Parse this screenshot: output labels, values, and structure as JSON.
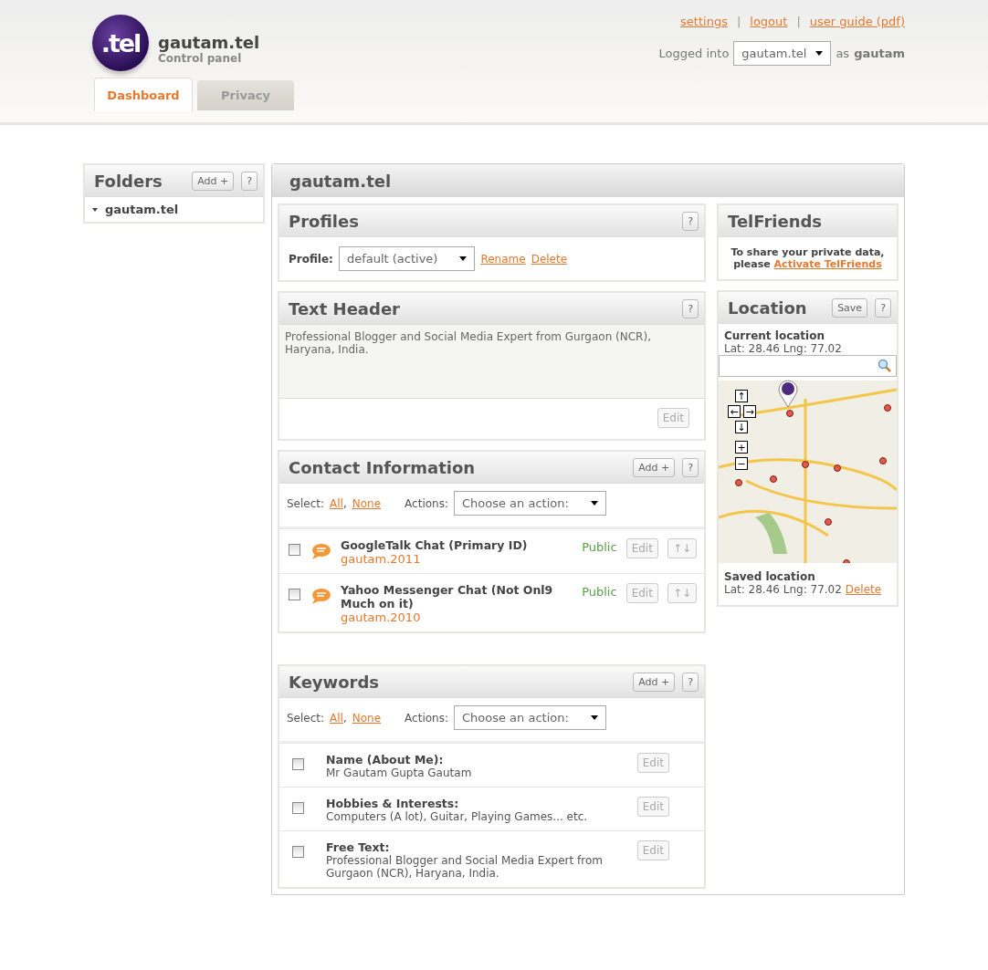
{
  "header": {
    "logo": ".tel",
    "site": "gautam.tel",
    "subtitle": "Control panel",
    "links": [
      "settings",
      "logout",
      "user guide (pdf)"
    ],
    "separator": "|",
    "logged_into_label": "Logged into",
    "account_select": "gautam.tel",
    "as_label": "as",
    "user": "gautam"
  },
  "tabs": [
    {
      "label": "Dashboard",
      "selected": true
    },
    {
      "label": "Privacy",
      "selected": false
    }
  ],
  "folders": {
    "title": "Folders",
    "add_button": "Add +",
    "help_button": "?",
    "items": [
      {
        "label": "gautam.tel",
        "expanded": true
      }
    ]
  },
  "main": {
    "title": "gautam.tel",
    "profiles": {
      "title": "Profiles",
      "help_button": "?",
      "label": "Profile:",
      "select": "default (active)",
      "links": [
        "Rename",
        "Delete"
      ]
    },
    "text_header": {
      "title": "Text Header",
      "help_button": "?",
      "text": "Professional Blogger and Social Media Expert from Gurgaon (NCR), Haryana, India.",
      "edit_button": "Edit"
    },
    "contacts": {
      "title": "Contact Information",
      "add_button": "Add +",
      "help_button": "?",
      "select_label": "Select:",
      "select_links": [
        "All",
        "None"
      ],
      "link_separator": ",",
      "actions_label": "Actions:",
      "actions_select": "Choose an action:",
      "items": [
        {
          "title": "GoogleTalk Chat (Primary ID)",
          "value": "gautam.2011",
          "visibility": "Public",
          "edit_button": "Edit",
          "move_button": "↑↓",
          "checked": false
        },
        {
          "title": "Yahoo Messenger Chat (Not Onl9 Much on it)",
          "value": "gautam.2010",
          "visibility": "Public",
          "edit_button": "Edit",
          "move_button": "↑↓",
          "checked": false
        }
      ]
    },
    "keywords": {
      "title": "Keywords",
      "add_button": "Add +",
      "help_button": "?",
      "select_label": "Select:",
      "select_links": [
        "All",
        "None"
      ],
      "link_separator": ",",
      "actions_label": "Actions:",
      "actions_select": "Choose an action:",
      "items": [
        {
          "title": "Name (About Me):",
          "value": "Mr Gautam Gupta Gautam",
          "edit_button": "Edit",
          "checked": false
        },
        {
          "title": "Hobbies & Interests:",
          "value": "Computers (A lot), Guitar, Playing Games... etc.",
          "edit_button": "Edit",
          "checked": false
        },
        {
          "title": "Free Text:",
          "value": "Professional Blogger and Social Media Expert from Gurgaon (NCR), Haryana, India.",
          "edit_button": "Edit",
          "checked": false
        }
      ]
    },
    "telfriends": {
      "title": "TelFriends",
      "text": "To share your private data, please",
      "link": "Activate TelFriends"
    },
    "location": {
      "title": "Location",
      "save_button": "Save",
      "help_button": "?",
      "current_label": "Current location",
      "current": "Lat: 28.46 Lng: 77.02",
      "map_controls": [
        "↑",
        "←",
        "→",
        "↓",
        "+",
        "−"
      ],
      "saved_label": "Saved location",
      "saved": "Lat: 28.46 Lng: 77.02",
      "delete_link": "Delete"
    }
  }
}
